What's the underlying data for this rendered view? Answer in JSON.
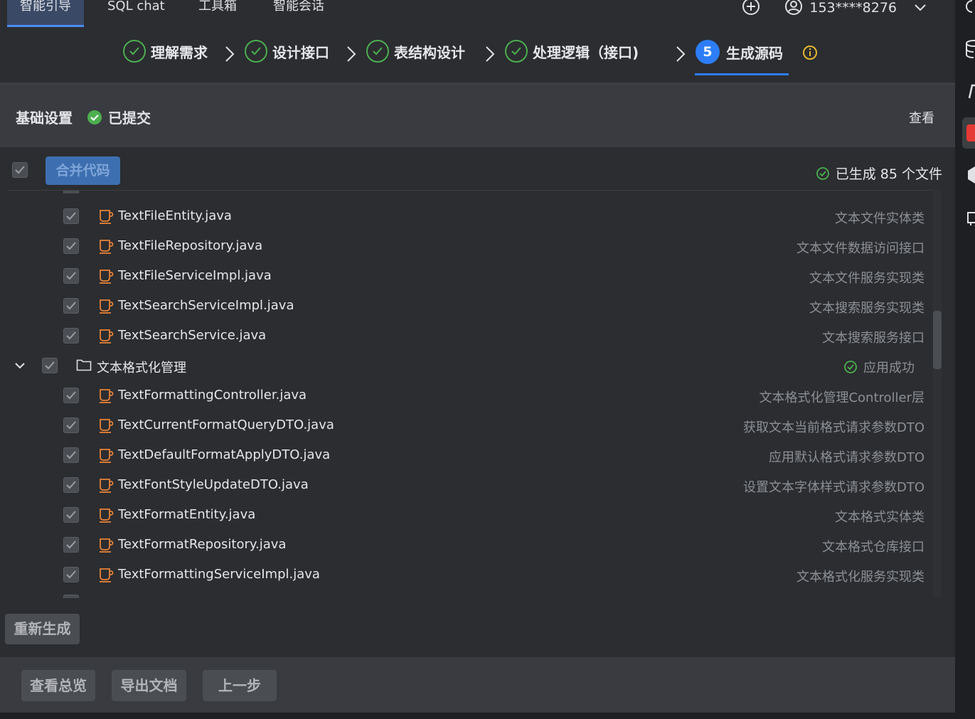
{
  "nav": {
    "tabs": [
      {
        "label": "智能引导",
        "active": true
      },
      {
        "label": "SQL chat",
        "active": false
      },
      {
        "label": "工具箱",
        "active": false
      },
      {
        "label": "智能会话",
        "active": false
      }
    ],
    "user": "153****8276"
  },
  "steps": [
    {
      "label": "理解需求",
      "state": "done"
    },
    {
      "label": "设计接口",
      "state": "done"
    },
    {
      "label": "表结构设计",
      "state": "done"
    },
    {
      "label": "处理逻辑（接口)",
      "state": "done"
    },
    {
      "label": "生成源码",
      "state": "active",
      "number": "5"
    }
  ],
  "base": {
    "title": "基础设置",
    "status": "已提交",
    "view_label": "查看"
  },
  "toolbar": {
    "merge_label": "合并代码",
    "generated_text": "已生成 85 个文件"
  },
  "files_top": [
    {
      "name": "TextFileEntity.java",
      "desc": "文本文件实体类"
    },
    {
      "name": "TextFileRepository.java",
      "desc": "文本文件数据访问接口"
    },
    {
      "name": "TextFileServiceImpl.java",
      "desc": "文本文件服务实现类"
    },
    {
      "name": "TextSearchServiceImpl.java",
      "desc": "文本搜索服务实现类"
    },
    {
      "name": "TextSearchService.java",
      "desc": "文本搜索服务接口"
    }
  ],
  "folder": {
    "name": "文本格式化管理",
    "status": "应用成功"
  },
  "files_bottom": [
    {
      "name": "TextFormattingController.java",
      "desc": "文本格式化管理Controller层"
    },
    {
      "name": "TextCurrentFormatQueryDTO.java",
      "desc": "获取文本当前格式请求参数DTO"
    },
    {
      "name": "TextDefaultFormatApplyDTO.java",
      "desc": "应用默认格式请求参数DTO"
    },
    {
      "name": "TextFontStyleUpdateDTO.java",
      "desc": "设置文本字体样式请求参数DTO"
    },
    {
      "name": "TextFormatEntity.java",
      "desc": "文本格式实体类"
    },
    {
      "name": "TextFormatRepository.java",
      "desc": "文本格式仓库接口"
    },
    {
      "name": "TextFormattingServiceImpl.java",
      "desc": "文本格式化服务实现类"
    }
  ],
  "actions": {
    "regenerate": "重新生成",
    "overview": "查看总览",
    "export": "导出文档",
    "prev": "上一步"
  }
}
